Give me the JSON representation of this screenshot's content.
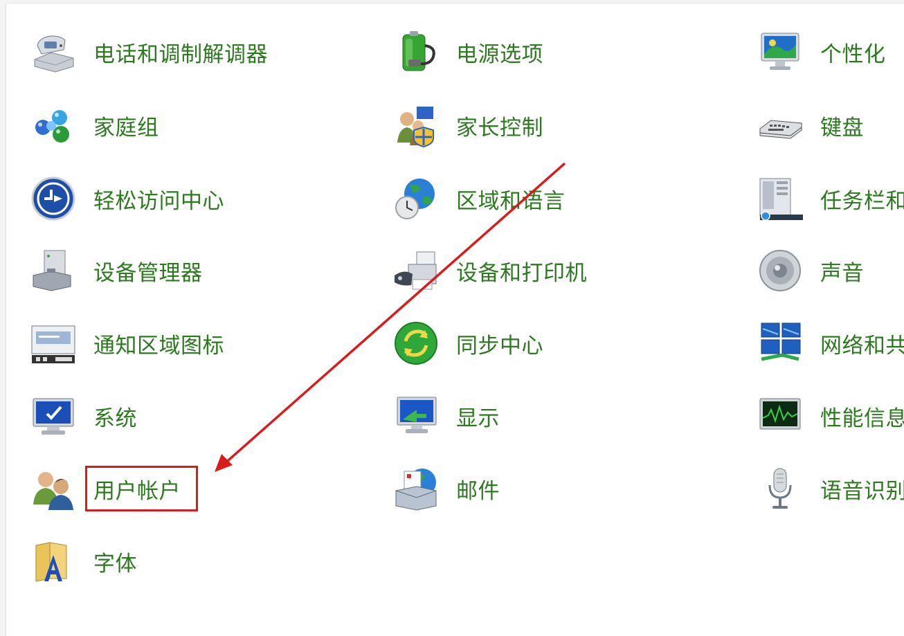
{
  "control_panel": {
    "items": [
      {
        "label": "电话和调制解调器",
        "icon": "phone-modem-icon"
      },
      {
        "label": "电源选项",
        "icon": "power-options-icon"
      },
      {
        "label": "个性化",
        "icon": "personalization-icon"
      },
      {
        "label": "家庭组",
        "icon": "homegroup-icon"
      },
      {
        "label": "家长控制",
        "icon": "parental-controls-icon"
      },
      {
        "label": "键盘",
        "icon": "keyboard-icon"
      },
      {
        "label": "轻松访问中心",
        "icon": "ease-of-access-icon"
      },
      {
        "label": "区域和语言",
        "icon": "region-language-icon"
      },
      {
        "label": "任务栏和",
        "icon": "taskbar-icon"
      },
      {
        "label": "设备管理器",
        "icon": "device-manager-icon"
      },
      {
        "label": "设备和打印机",
        "icon": "devices-printers-icon"
      },
      {
        "label": "声音",
        "icon": "sound-icon"
      },
      {
        "label": "通知区域图标",
        "icon": "notification-area-icon"
      },
      {
        "label": "同步中心",
        "icon": "sync-center-icon"
      },
      {
        "label": "网络和共",
        "icon": "network-sharing-icon"
      },
      {
        "label": "系统",
        "icon": "system-icon"
      },
      {
        "label": "显示",
        "icon": "display-icon"
      },
      {
        "label": "性能信息",
        "icon": "performance-info-icon"
      },
      {
        "label": "用户帐户",
        "icon": "user-accounts-icon"
      },
      {
        "label": "邮件",
        "icon": "mail-icon"
      },
      {
        "label": "语音识别",
        "icon": "speech-recognition-icon"
      },
      {
        "label": "字体",
        "icon": "fonts-icon"
      }
    ]
  },
  "annotation": {
    "highlight_color": "#d81c1c",
    "highlighted_item": "用户帐户"
  },
  "colors": {
    "link_green": "#2b7a1e",
    "background": "#ffffff"
  }
}
